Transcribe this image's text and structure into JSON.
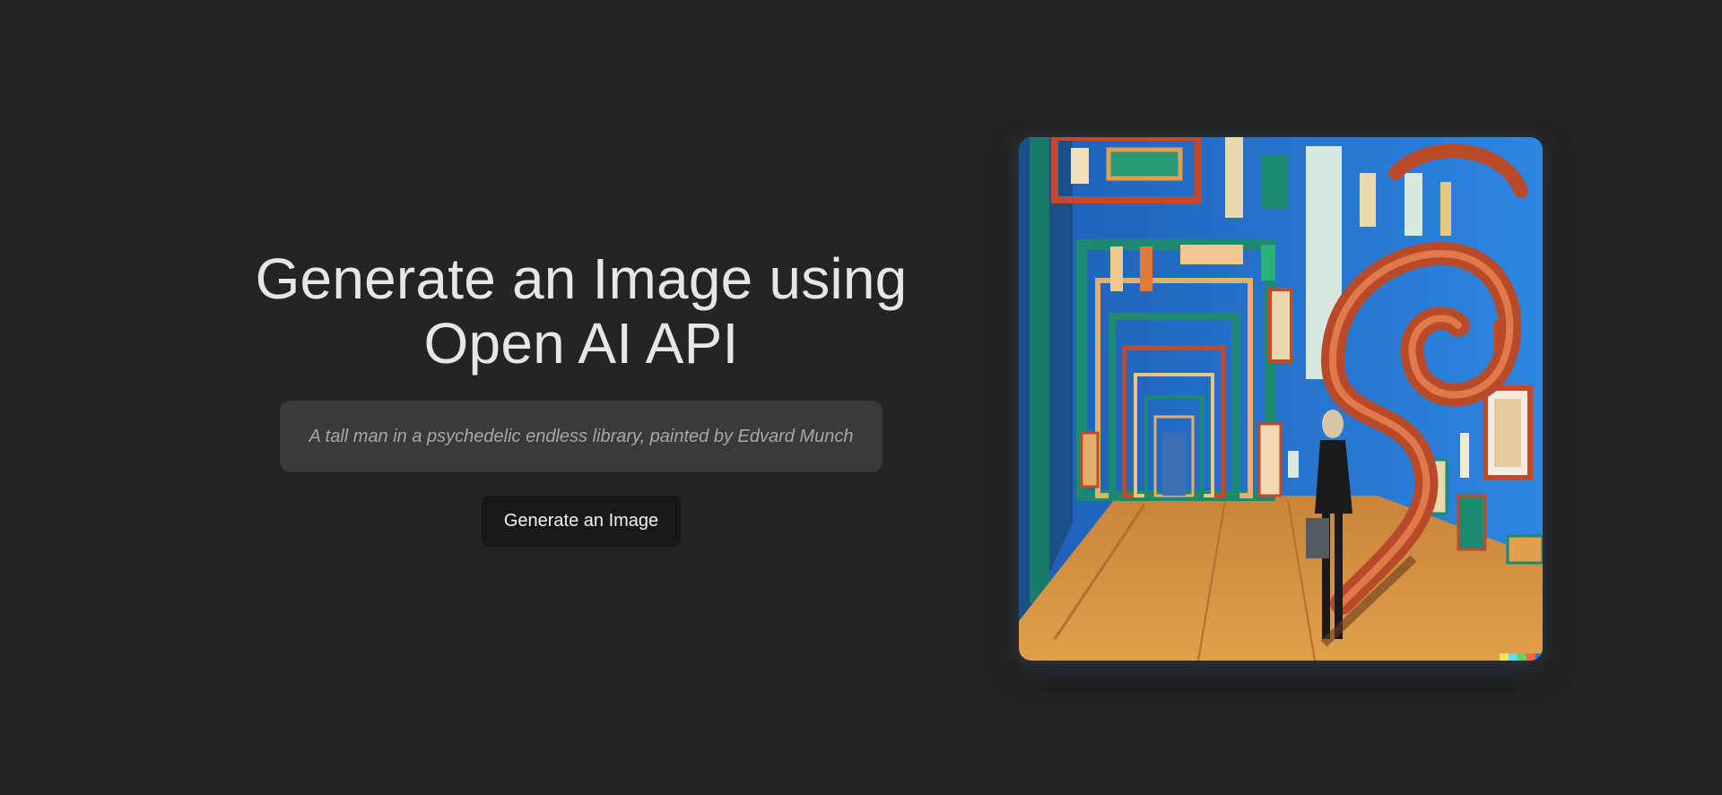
{
  "header": {
    "title_line1": "Generate an Image using",
    "title_line2": "Open AI API"
  },
  "form": {
    "prompt_value": "",
    "prompt_placeholder": "A tall man in a psychedelic endless library, painted by Edvard Munch",
    "button_label": "Generate an Image"
  },
  "colors": {
    "background": "#242424",
    "input_background": "#3a3a3a",
    "button_background": "#181818",
    "text": "#e6e6e6"
  }
}
